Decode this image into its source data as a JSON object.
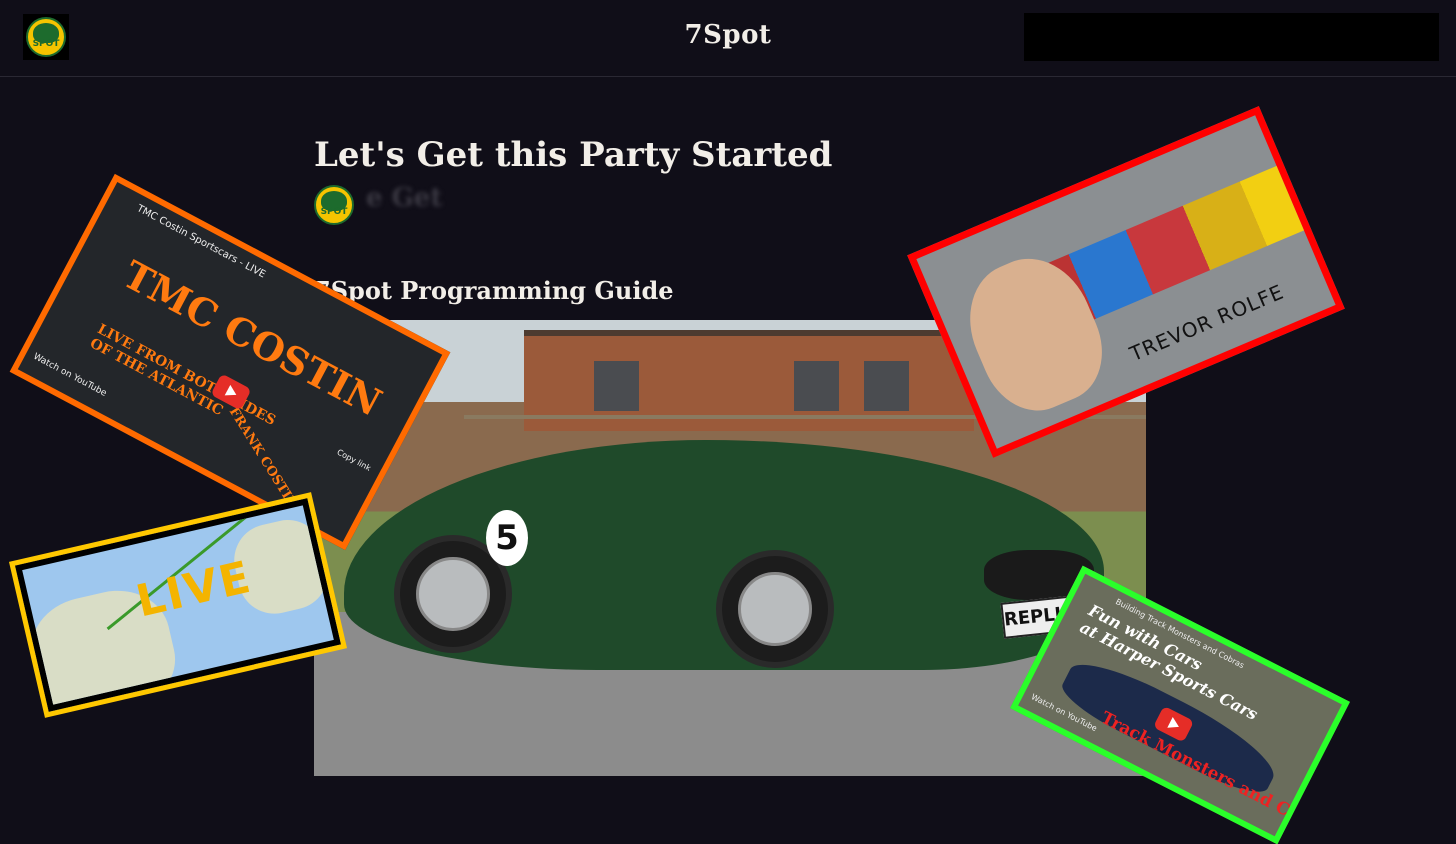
{
  "header": {
    "site_title": "7Spot",
    "logo_text": "SPOT"
  },
  "post": {
    "title": "Let's Get this Party Started",
    "author_blurred": "e Get",
    "section_title": "7Spot Programming Guide"
  },
  "hero": {
    "number": "5",
    "plate": "REPLICAR"
  },
  "embeds": {
    "tmc": {
      "channel": "TMC Costin Sportscars - LIVE",
      "headline": "TMC COSTIN",
      "subline": "LIVE FROM BOTH SIDES OF THE ATLANTIC",
      "caption": "FRANK COSTIN",
      "watch_on": "Watch on YouTube",
      "copy_link": "Copy link"
    },
    "live": {
      "label": "LIVE"
    },
    "trevor": {
      "name": "TREVOR ROLFE"
    },
    "track": {
      "channel": "Building Track Monsters and Cobras",
      "line1": "Fun with Cars",
      "line2": "at Harper Sports Cars",
      "line3": "Track Monsters and Cobras",
      "watch_on": "Watch on YouTube"
    }
  },
  "colors": {
    "background": "#100e18",
    "tmc_border": "#ff6a00",
    "live_border": "#ffc800",
    "trevor_border": "#ff0000",
    "track_border": "#2aff2a"
  }
}
